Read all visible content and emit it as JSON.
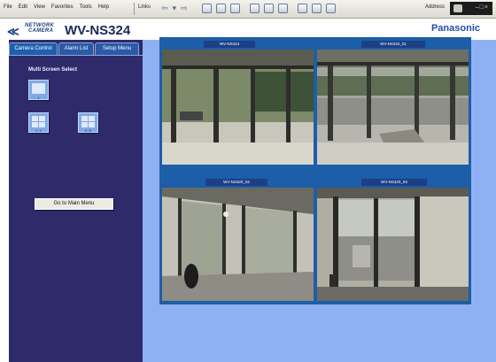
{
  "browser": {
    "menu": [
      "File",
      "Edit",
      "View",
      "Favorites",
      "Tools",
      "Help"
    ],
    "links_label": "Links",
    "address_label": "Address"
  },
  "header": {
    "brand_line1": "NETWORK",
    "brand_line2": "CAMERA",
    "model": "WV-NS324",
    "maker": "Panasonic"
  },
  "tabs": [
    "Camera Control",
    "Alarm List",
    "Setup Menu"
  ],
  "multi_screen": {
    "title": "Multi Screen Select",
    "buttons": [
      {
        "label": "1"
      },
      {
        "label": "1~4"
      },
      {
        "label": "5~8"
      }
    ]
  },
  "main_menu_label": "Go to Main Menu",
  "cameras": [
    {
      "title": "WV-NS324"
    },
    {
      "title": "WV-NS320_01"
    },
    {
      "title": "WV-NS320_02"
    },
    {
      "title": "WV-NS320_03"
    }
  ],
  "colors": {
    "left_panel": "#2f2a6a",
    "right_panel": "#8fb1f3",
    "grid_frame": "#1c5ea8",
    "cam_title_bg": "#1d3f86",
    "brand": "#1f4fa8"
  }
}
